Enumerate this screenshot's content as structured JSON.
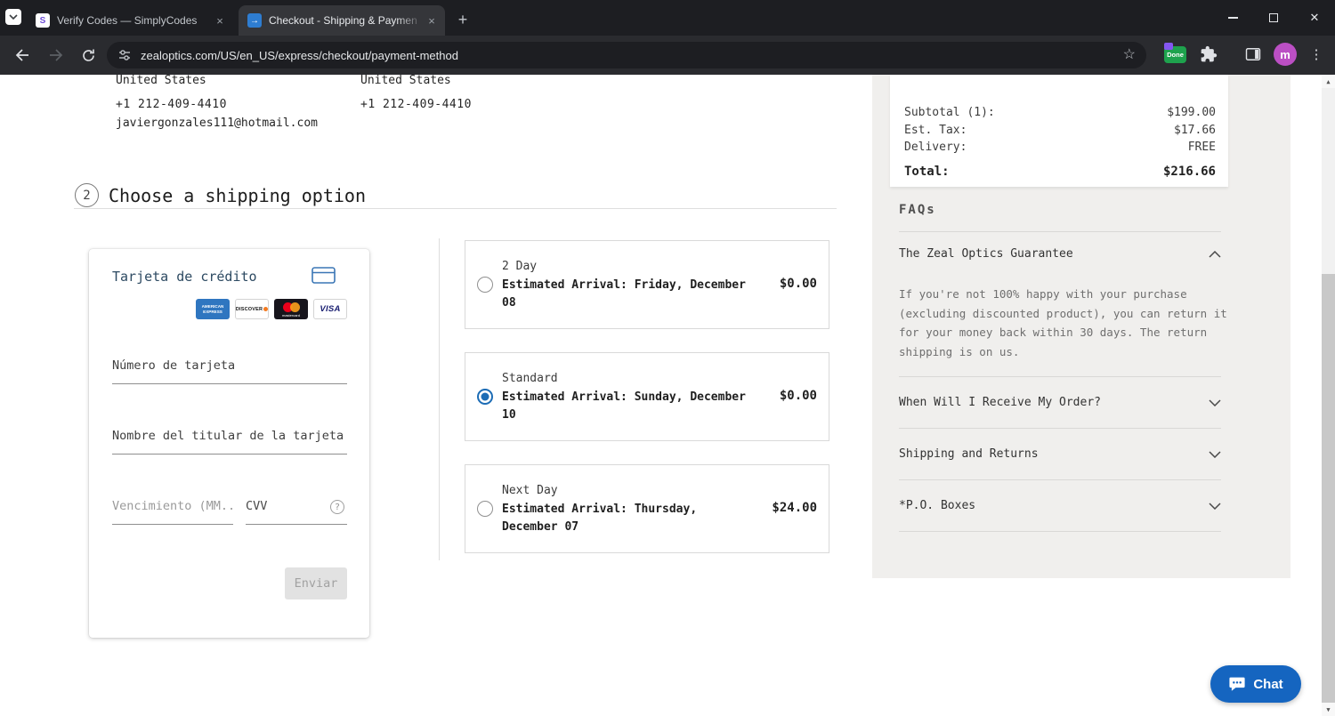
{
  "browser": {
    "tabs": [
      {
        "title": "Verify Codes — SimplyCodes"
      },
      {
        "title": "Checkout - Shipping & Paymen"
      }
    ],
    "url": "zealoptics.com/US/en_US/express/checkout/payment-method",
    "extension_badge_label": "Done",
    "avatar_letter": "m"
  },
  "contact": {
    "shipping_country": "United States",
    "billing_country": "United States",
    "shipping_phone": "+1 212-409-4410",
    "billing_phone": "+1 212-409-4410",
    "email": "javiergonzales111@hotmail.com"
  },
  "shipping_section": {
    "step_number": "2",
    "title": "Choose a shipping option",
    "options": [
      {
        "name": "2 Day",
        "arrival": "Estimated Arrival: Friday, December 08",
        "price": "$0.00",
        "selected": false
      },
      {
        "name": "Standard",
        "arrival": "Estimated Arrival: Sunday, December 10",
        "price": "$0.00",
        "selected": true
      },
      {
        "name": "Next Day",
        "arrival": "Estimated Arrival: Thursday, December 07",
        "price": "$24.00",
        "selected": false
      }
    ]
  },
  "payment_form": {
    "title": "Tarjeta de crédito",
    "card_brands": [
      "American Express",
      "Discover",
      "Mastercard",
      "Visa"
    ],
    "brand_labels": {
      "amex": "AMERICAN EXPRESS",
      "discover": "DISCOVER",
      "mastercard": "mastercard",
      "visa": "VISA"
    },
    "fields": {
      "card_number_placeholder": "Número de tarjeta",
      "card_holder_placeholder": "Nombre del titular de la tarjeta",
      "expiry_placeholder": "Vencimiento (MM...",
      "cvv_placeholder": "CVV"
    },
    "help_icon": "?",
    "submit_label": "Enviar"
  },
  "order_summary": {
    "rows": [
      {
        "label": "Subtotal (1):",
        "value": "$199.00"
      },
      {
        "label": "Est. Tax:",
        "value": "$17.66"
      },
      {
        "label": "Delivery:",
        "value": "FREE"
      }
    ],
    "total_label": "Total:",
    "total_value": "$216.66"
  },
  "faqs": {
    "title": "FAQs",
    "items": [
      {
        "label": "The Zeal Optics Guarantee",
        "expanded": true,
        "body": "If you're not 100% happy with your purchase (excluding discounted product), you can return it for your money back within 30 days. The return shipping is on us."
      },
      {
        "label": "When Will I Receive My Order?",
        "expanded": false
      },
      {
        "label": "Shipping and Returns",
        "expanded": false
      },
      {
        "label": "*P.O. Boxes",
        "expanded": false
      }
    ]
  },
  "chat": {
    "label": "Chat"
  },
  "colors": {
    "radio_selected": "#1c6cb5",
    "chat_button": "#1565c0",
    "sidebar_background": "#f0efed",
    "titlebar_background": "#1d1e22"
  }
}
